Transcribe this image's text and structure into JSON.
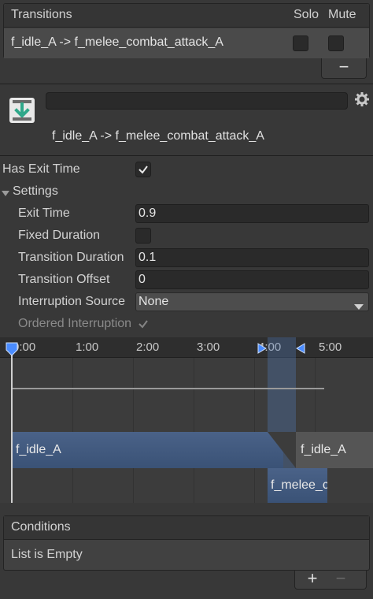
{
  "transitions": {
    "title": "Transitions",
    "solo_label": "Solo",
    "mute_label": "Mute",
    "row_label": "f_idle_A -> f_melee_combat_attack_A",
    "remove_label": "−"
  },
  "header": {
    "title": "f_idle_A -> f_melee_combat_attack_A",
    "name_value": ""
  },
  "properties": {
    "has_exit_time": {
      "label": "Has Exit Time",
      "checked": true
    },
    "settings": {
      "label": "Settings"
    },
    "exit_time": {
      "label": "Exit Time",
      "value": "0.9"
    },
    "fixed_duration": {
      "label": "Fixed Duration",
      "checked": false
    },
    "transition_duration": {
      "label": "Transition Duration",
      "value": "0.1"
    },
    "transition_offset": {
      "label": "Transition Offset",
      "value": "0"
    },
    "interruption_source": {
      "label": "Interruption Source",
      "value": "None"
    },
    "ordered_interruption": {
      "label": "Ordered Interruption",
      "checked": true
    }
  },
  "timeline": {
    "ticks": [
      "0:00",
      "1:00",
      "2:00",
      "3:00",
      "4:00",
      "5:00"
    ],
    "source_state": "f_idle_A",
    "source_state_repeat": "f_idle_A",
    "target_state": "f_melee_combat_attack_A"
  },
  "conditions": {
    "title": "Conditions",
    "empty_text": "List is Empty",
    "add_label": "+",
    "remove_label": "−"
  },
  "colors": {
    "panel_bg": "#383838",
    "field_bg": "#2a2a2a",
    "clip_blue": "#3f5a80",
    "accent_green": "#7fd0b8",
    "marker_blue": "#4a8cff"
  }
}
